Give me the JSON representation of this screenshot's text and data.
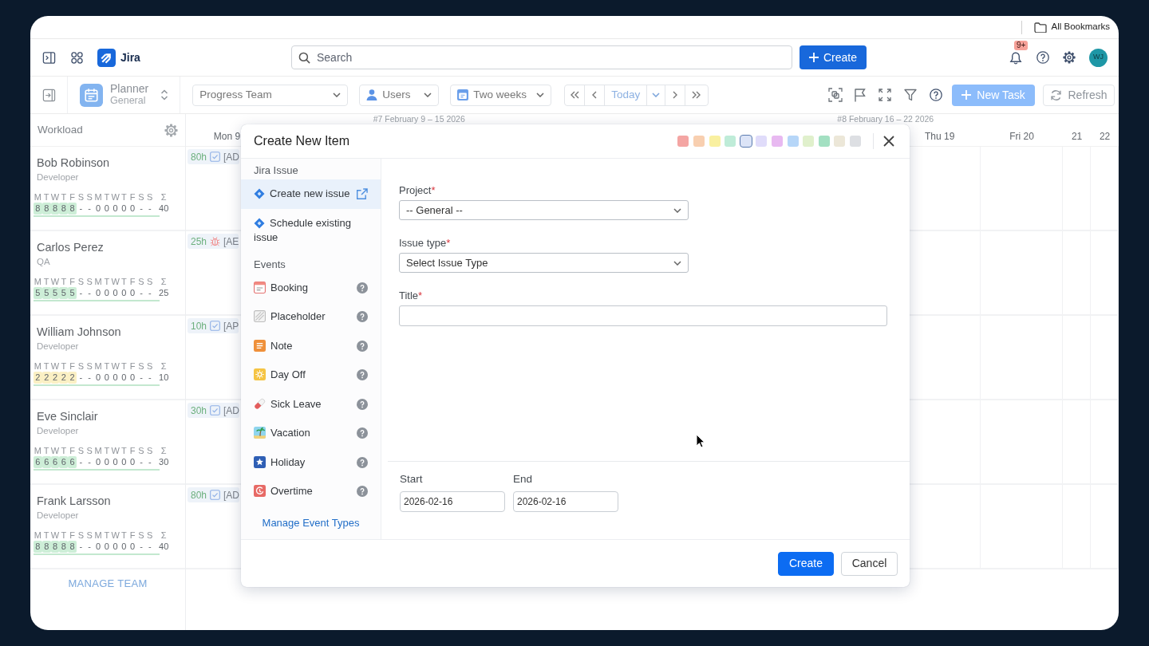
{
  "browser": {
    "bookmarks": "All Bookmarks"
  },
  "topnav": {
    "app_name": "Jira",
    "search": {
      "placeholder": "Search"
    },
    "create": "Create",
    "notifications_badge": "9+",
    "avatar": "WJ"
  },
  "toolbar": {
    "planner": {
      "title": "Planner",
      "subtitle": "General"
    },
    "team": "Progress Team",
    "users": "Users",
    "range": "Two weeks",
    "today": "Today",
    "new_task": {
      "label": "New Task",
      "disabled": true
    },
    "refresh": "Refresh"
  },
  "workload": {
    "title": "Workload",
    "manage": "MANAGE TEAM",
    "resources": [
      {
        "name": "Bob Robinson",
        "role": "Developer",
        "color": "#cdeed7",
        "days": [
          "M",
          "T",
          "W",
          "T",
          "F",
          "S",
          "S",
          "M",
          "T",
          "W",
          "T",
          "F",
          "S",
          "S"
        ],
        "sum_label": "Σ",
        "hours": [
          {
            "value": "8",
            "highlighted": true
          },
          {
            "value": "8",
            "highlighted": true
          },
          {
            "value": "8",
            "highlighted": true
          },
          {
            "value": "8",
            "highlighted": true
          },
          {
            "value": "8",
            "highlighted": true
          },
          {
            "value": "-",
            "highlighted": false
          },
          {
            "value": "-",
            "highlighted": false
          },
          {
            "value": "0",
            "highlighted": false
          },
          {
            "value": "0",
            "highlighted": false
          },
          {
            "value": "0",
            "highlighted": false
          },
          {
            "value": "0",
            "highlighted": false
          },
          {
            "value": "0",
            "highlighted": false
          },
          {
            "value": "-",
            "highlighted": false
          },
          {
            "value": "-",
            "highlighted": false
          }
        ],
        "total": "40",
        "task": {
          "hours": "80h",
          "kind": "task",
          "key": "[AD"
        }
      },
      {
        "name": "Carlos Perez",
        "role": "QA",
        "color": "#cdeed7",
        "days": [
          "M",
          "T",
          "W",
          "T",
          "F",
          "S",
          "S",
          "M",
          "T",
          "W",
          "T",
          "F",
          "S",
          "S"
        ],
        "sum_label": "Σ",
        "hours": [
          {
            "value": "5",
            "highlighted": true
          },
          {
            "value": "5",
            "highlighted": true
          },
          {
            "value": "5",
            "highlighted": true
          },
          {
            "value": "5",
            "highlighted": true
          },
          {
            "value": "5",
            "highlighted": true
          },
          {
            "value": "-",
            "highlighted": false
          },
          {
            "value": "-",
            "highlighted": false
          },
          {
            "value": "0",
            "highlighted": false
          },
          {
            "value": "0",
            "highlighted": false
          },
          {
            "value": "0",
            "highlighted": false
          },
          {
            "value": "0",
            "highlighted": false
          },
          {
            "value": "0",
            "highlighted": false
          },
          {
            "value": "-",
            "highlighted": false
          },
          {
            "value": "-",
            "highlighted": false
          }
        ],
        "total": "25",
        "task": {
          "hours": "25h",
          "kind": "bug",
          "key": "[AE"
        }
      },
      {
        "name": "William Johnson",
        "role": "Developer",
        "color": "#fbf0c4",
        "days": [
          "M",
          "T",
          "W",
          "T",
          "F",
          "S",
          "S",
          "M",
          "T",
          "W",
          "T",
          "F",
          "S",
          "S"
        ],
        "sum_label": "Σ",
        "hours": [
          {
            "value": "2",
            "highlighted": true
          },
          {
            "value": "2",
            "highlighted": true
          },
          {
            "value": "2",
            "highlighted": true
          },
          {
            "value": "2",
            "highlighted": true
          },
          {
            "value": "2",
            "highlighted": true
          },
          {
            "value": "-",
            "highlighted": false
          },
          {
            "value": "-",
            "highlighted": false
          },
          {
            "value": "0",
            "highlighted": false
          },
          {
            "value": "0",
            "highlighted": false
          },
          {
            "value": "0",
            "highlighted": false
          },
          {
            "value": "0",
            "highlighted": false
          },
          {
            "value": "0",
            "highlighted": false
          },
          {
            "value": "-",
            "highlighted": false
          },
          {
            "value": "-",
            "highlighted": false
          }
        ],
        "total": "10",
        "task": {
          "hours": "10h",
          "kind": "task",
          "key": "[AP"
        }
      },
      {
        "name": "Eve Sinclair",
        "role": "Developer",
        "color": "#cdeed7",
        "days": [
          "M",
          "T",
          "W",
          "T",
          "F",
          "S",
          "S",
          "M",
          "T",
          "W",
          "T",
          "F",
          "S",
          "S"
        ],
        "sum_label": "Σ",
        "hours": [
          {
            "value": "6",
            "highlighted": true
          },
          {
            "value": "6",
            "highlighted": true
          },
          {
            "value": "6",
            "highlighted": true
          },
          {
            "value": "6",
            "highlighted": true
          },
          {
            "value": "6",
            "highlighted": true
          },
          {
            "value": "-",
            "highlighted": false
          },
          {
            "value": "-",
            "highlighted": false
          },
          {
            "value": "0",
            "highlighted": false
          },
          {
            "value": "0",
            "highlighted": false
          },
          {
            "value": "0",
            "highlighted": false
          },
          {
            "value": "0",
            "highlighted": false
          },
          {
            "value": "0",
            "highlighted": false
          },
          {
            "value": "-",
            "highlighted": false
          },
          {
            "value": "-",
            "highlighted": false
          }
        ],
        "total": "30",
        "task": {
          "hours": "30h",
          "kind": "task",
          "key": "[AD"
        }
      },
      {
        "name": "Frank Larsson",
        "role": "Developer",
        "color": "#cdeed7",
        "days": [
          "M",
          "T",
          "W",
          "T",
          "F",
          "S",
          "S",
          "M",
          "T",
          "W",
          "T",
          "F",
          "S",
          "S"
        ],
        "sum_label": "Σ",
        "hours": [
          {
            "value": "8",
            "highlighted": true
          },
          {
            "value": "8",
            "highlighted": true
          },
          {
            "value": "8",
            "highlighted": true
          },
          {
            "value": "8",
            "highlighted": true
          },
          {
            "value": "8",
            "highlighted": true
          },
          {
            "value": "-",
            "highlighted": false
          },
          {
            "value": "-",
            "highlighted": false
          },
          {
            "value": "0",
            "highlighted": false
          },
          {
            "value": "0",
            "highlighted": false
          },
          {
            "value": "0",
            "highlighted": false
          },
          {
            "value": "0",
            "highlighted": false
          },
          {
            "value": "0",
            "highlighted": false
          },
          {
            "value": "-",
            "highlighted": false
          },
          {
            "value": "-",
            "highlighted": false
          }
        ],
        "total": "40",
        "task": {
          "hours": "80h",
          "kind": "task",
          "key": "[AD"
        }
      }
    ]
  },
  "timeline": {
    "weeks": [
      "#7 February 9 – 15 2026",
      "#8 February 16 – 22 2026"
    ],
    "days": [
      {
        "label": "Mon 9",
        "kind": "weekday"
      },
      {
        "kind": "weekday"
      },
      {
        "kind": "weekday"
      },
      {
        "kind": "weekday"
      },
      {
        "kind": "weekday"
      },
      {
        "kind": "weekend"
      },
      {
        "kind": "weekend"
      },
      {
        "kind": "weekday"
      },
      {
        "kind": "weekday"
      },
      {
        "kind": "weekday"
      },
      {
        "label": "Thu 19",
        "kind": "weekday"
      },
      {
        "label": "Fri 20",
        "kind": "weekday"
      },
      {
        "label": "21",
        "kind": "weekend"
      },
      {
        "label": "22",
        "kind": "weekend"
      }
    ]
  },
  "dialog": {
    "title": "Create New Item",
    "colors": [
      {
        "color": "#f4a5a3",
        "selected": false
      },
      {
        "color": "#f8cfb0",
        "selected": false
      },
      {
        "color": "#f9f0a0",
        "selected": false
      },
      {
        "color": "#bfecd8",
        "selected": false
      },
      {
        "color": "#dce4f7",
        "selected": true
      },
      {
        "color": "#e0dcfa",
        "selected": false
      },
      {
        "color": "#e8b9f1",
        "selected": false
      },
      {
        "color": "#b6d6f8",
        "selected": false
      },
      {
        "color": "#e0f0cc",
        "selected": false
      },
      {
        "color": "#a3e0c2",
        "selected": false
      },
      {
        "color": "#ece7d8",
        "selected": false
      },
      {
        "color": "#dddfe3",
        "selected": false
      }
    ],
    "sections": [
      {
        "title": "Jira Issue",
        "items": [
          {
            "label": "Create new issue",
            "kind": "jira",
            "selected": true,
            "external": true
          },
          {
            "label": "Schedule existing issue",
            "kind": "jira",
            "selected": false,
            "external": false
          }
        ]
      },
      {
        "title": "Events",
        "items": [
          {
            "label": "Booking",
            "kind": "booking",
            "selected": false,
            "help": true
          },
          {
            "label": "Placeholder",
            "kind": "placeholder",
            "selected": false,
            "help": true
          },
          {
            "label": "Note",
            "kind": "note",
            "selected": false,
            "help": true
          },
          {
            "label": "Day Off",
            "kind": "dayoff",
            "selected": false,
            "help": true
          },
          {
            "label": "Sick Leave",
            "kind": "sick",
            "selected": false,
            "help": true
          },
          {
            "label": "Vacation",
            "kind": "vacation",
            "selected": false,
            "help": true
          },
          {
            "label": "Holiday",
            "kind": "holiday",
            "selected": false,
            "help": true
          },
          {
            "label": "Overtime",
            "kind": "overtime",
            "selected": false,
            "help": true
          }
        ]
      }
    ],
    "manage_link": "Manage Event Types",
    "fields": [
      {
        "label": "Project",
        "required_mark": "*",
        "kind": "select",
        "value": "-- General --"
      },
      {
        "label": "Issue type",
        "required_mark": "*",
        "kind": "select",
        "value": "Select Issue Type"
      },
      {
        "label": "Title",
        "required_mark": "*",
        "kind": "text"
      }
    ],
    "dates": [
      {
        "label": "Start",
        "value": "2026-02-16"
      },
      {
        "label": "End",
        "value": "2026-02-16"
      }
    ],
    "buttons": [
      {
        "label": "Create",
        "kind": "primary"
      },
      {
        "label": "Cancel",
        "kind": "secondary"
      }
    ]
  }
}
